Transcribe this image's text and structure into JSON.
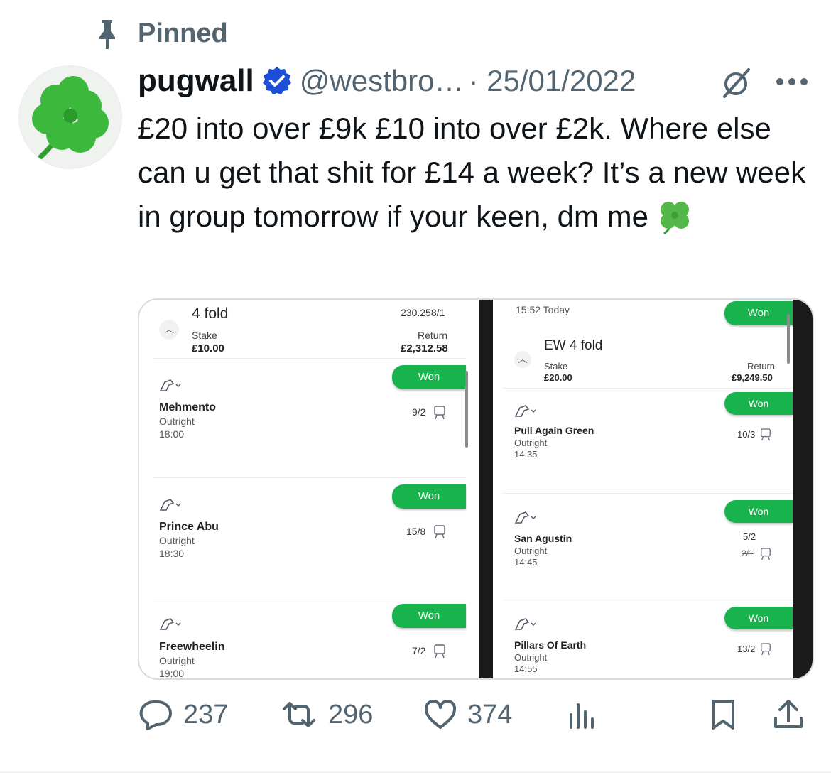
{
  "pinned": {
    "label": "Pinned"
  },
  "author": {
    "name": "pugwall",
    "handle": "@westbro…",
    "date": "· 25/01/2022"
  },
  "tweet": {
    "text": "£20 into over £9k £10 into over £2k. Where else can u get that shit for £14 a week? It’s a new week in group tomorrow if your keen, dm me"
  },
  "media": {
    "left": {
      "title": "4 fold",
      "odds_total": "230.258/1",
      "stake_label": "Stake",
      "stake_value": "£10.00",
      "return_label": "Return",
      "return_value": "£2,312.58",
      "legs": [
        {
          "status": "Won",
          "horse": "Mehmento",
          "market": "Outright",
          "time": "18:00",
          "odds": "9/2"
        },
        {
          "status": "Won",
          "horse": "Prince Abu",
          "market": "Outright",
          "time": "18:30",
          "odds": "15/8"
        },
        {
          "status": "Won",
          "horse": "Freewheelin",
          "market": "Outright",
          "time": "19:00",
          "odds": "7/2"
        }
      ]
    },
    "right": {
      "timestamp": "15:52 Today",
      "top_status": "Won",
      "title": "EW 4 fold",
      "stake_label": "Stake",
      "stake_value": "£20.00",
      "return_label": "Return",
      "return_value": "£9,249.50",
      "legs": [
        {
          "status": "Won",
          "horse": "Pull Again Green",
          "market": "Outright",
          "time": "14:35",
          "odds": "10/3",
          "old_odds": ""
        },
        {
          "status": "Won",
          "horse": "San Agustin",
          "market": "Outright",
          "time": "14:45",
          "odds": "5/2",
          "old_odds": "2/1"
        },
        {
          "status": "Won",
          "horse": "Pillars Of Earth",
          "market": "Outright",
          "time": "14:55",
          "odds": "13/2",
          "old_odds": ""
        }
      ]
    }
  },
  "actions": {
    "replies": "237",
    "reposts": "296",
    "likes": "374"
  },
  "colors": {
    "accent": "#1d9bf0",
    "won_green": "#19b34e",
    "muted": "#536471",
    "verified": "#1d9bf0"
  },
  "icons": [
    "pin-icon",
    "verified-badge-icon",
    "grok-icon",
    "more-icon",
    "clover-emoji",
    "reply-icon",
    "repost-icon",
    "like-icon",
    "views-icon",
    "bookmark-icon",
    "share-icon",
    "horse-icon",
    "chevron-down-icon",
    "certificate-icon"
  ]
}
